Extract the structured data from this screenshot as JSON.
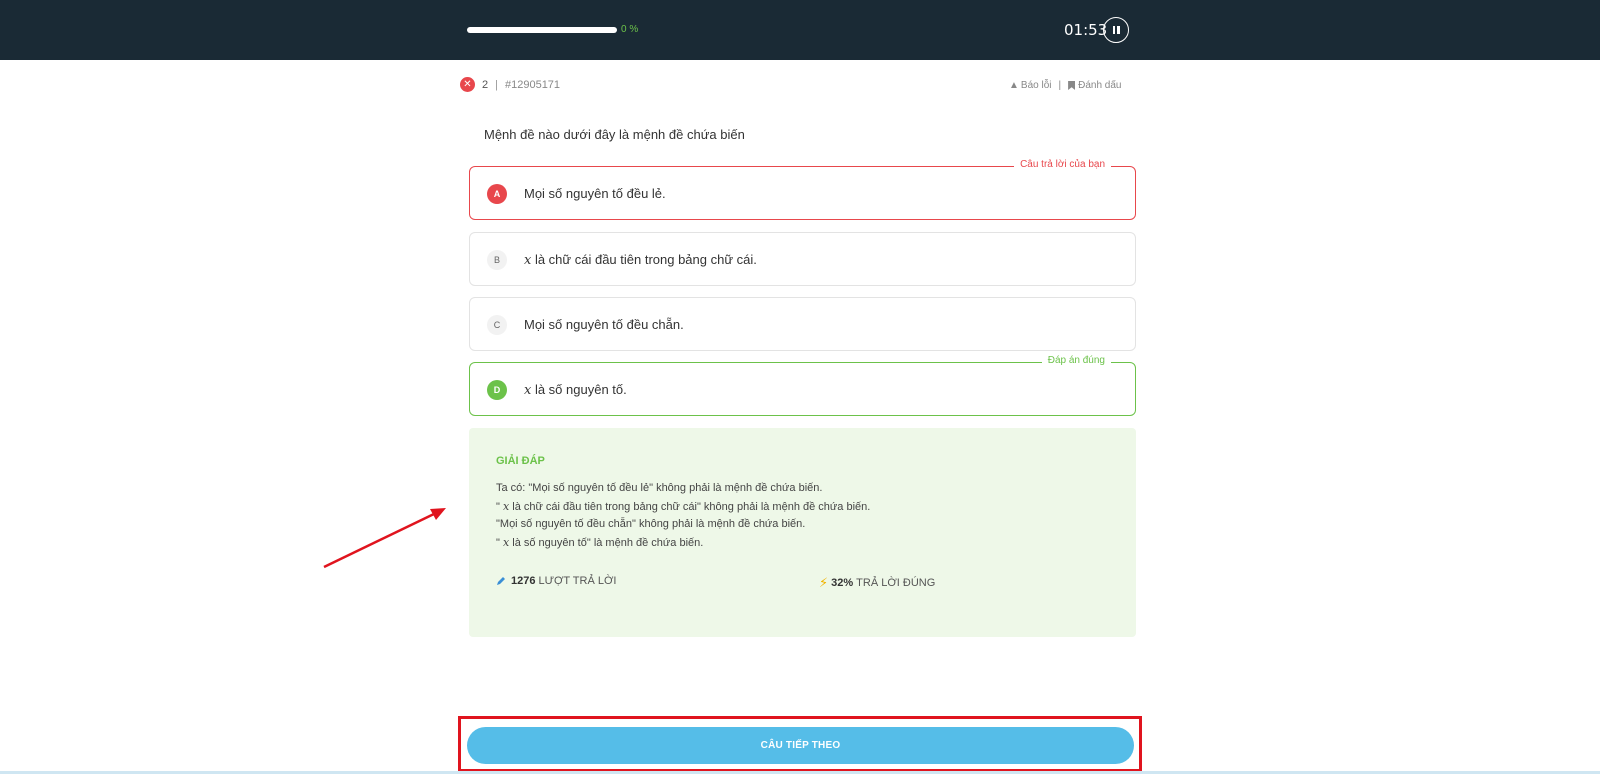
{
  "header": {
    "progress_percent": 0,
    "progress_label": "0 %",
    "timer": "01:53"
  },
  "meta": {
    "question_number": "2",
    "separator": "|",
    "question_id": "#12905171",
    "report_label": "Báo lỗi",
    "bookmark_label": "Đánh dấu"
  },
  "question": "Mệnh đề nào dưới đây là mệnh đề chứa biến",
  "options": [
    {
      "letter": "A",
      "var": "",
      "text": "Mọi số nguyên tố đều lẻ.",
      "tag": "Câu trả lời của bạn"
    },
    {
      "letter": "B",
      "var": "x",
      "text": " là chữ cái đầu tiên trong bảng chữ cái.",
      "tag": ""
    },
    {
      "letter": "C",
      "var": "",
      "text": "Mọi số nguyên tố đều chẵn.",
      "tag": ""
    },
    {
      "letter": "D",
      "var": "x",
      "text": " là số nguyên tố.",
      "tag": "Đáp án đúng"
    }
  ],
  "explanation": {
    "title": "GIẢI ĐÁP",
    "line1": "Ta có: \"Mọi số nguyên tố đều lẻ\" không phải là mệnh đề chứa biến.",
    "line2_pre": "\" ",
    "line2_var": "x",
    "line2_post": " là chữ cái đầu tiên trong bảng chữ cái\" không phải là mệnh đề chứa biến.",
    "line3": "\"Mọi số nguyên tố đều chẵn\" không phải là mệnh đề chứa biến.",
    "line4_pre": "\" ",
    "line4_var": "x",
    "line4_post": " là số nguyên tố\" là mệnh đề chứa biến.",
    "answers_count": "1276",
    "answers_label": "LƯỢT TRẢ LỜI",
    "correct_pct": "32%",
    "correct_label": "TRẢ LỜI ĐÚNG"
  },
  "next_button": "CÂU TIẾP THEO",
  "colors": {
    "wrong": "#e8474c",
    "correct": "#6cc24a",
    "button": "#55bde8",
    "topbar": "#1a2a35",
    "highlight": "#e0141e"
  }
}
